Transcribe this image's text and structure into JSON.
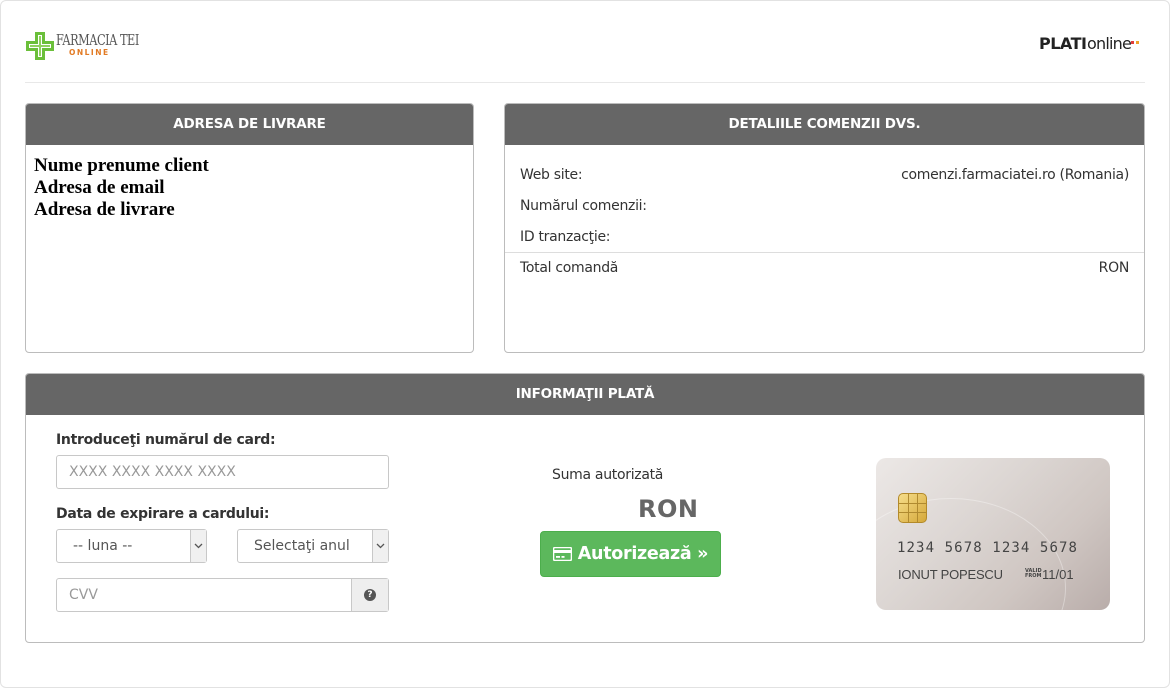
{
  "header": {
    "brand_left_line1": "FARMACIA TEI",
    "brand_left_line2": "ONLINE",
    "brand_right_part1": "PLATI",
    "brand_right_part2": "online",
    "brand_left_colors": {
      "green": "#6bbf3a",
      "orange": "#e27a23"
    },
    "brand_right_dot_colors": [
      "#e23b3b",
      "#f1a32a",
      "#3a7bd5"
    ]
  },
  "shipping": {
    "title": "ADRESA DE LIVRARE",
    "lines": [
      "Nume prenume client",
      "Adresa de email",
      "Adresa de livrare"
    ]
  },
  "order": {
    "title": "DETALIILE COMENZII DVS.",
    "rows": [
      {
        "label": "Web site:",
        "value": "comenzi.farmaciatei.ro (Romania)"
      },
      {
        "label": "Numărul comenzii:",
        "value": ""
      },
      {
        "label": "ID tranzacţie:",
        "value": ""
      }
    ],
    "total": {
      "label": "Total comandă",
      "value": "RON"
    }
  },
  "payment": {
    "title": "INFORMAŢII PLATĂ",
    "card_number_label": "Introduceţi numărul de card:",
    "card_number_placeholder": "XXXX XXXX XXXX XXXX",
    "expiry_label": "Data de expirare a cardului:",
    "month_selected": "-- luna --",
    "year_selected": "Selectaţi anul",
    "cvv_placeholder": "CVV",
    "authorized_label": "Suma autorizată",
    "authorized_amount": "RON",
    "authorize_button": "Autorizează »",
    "button_color": "#5cb85c"
  },
  "card_preview": {
    "number": "1234 5678 1234 5678",
    "holder": "IONUT POPESCU",
    "valid_from_label_1": "VALID",
    "valid_from_label_2": "FROM",
    "expiry": "11/01"
  }
}
